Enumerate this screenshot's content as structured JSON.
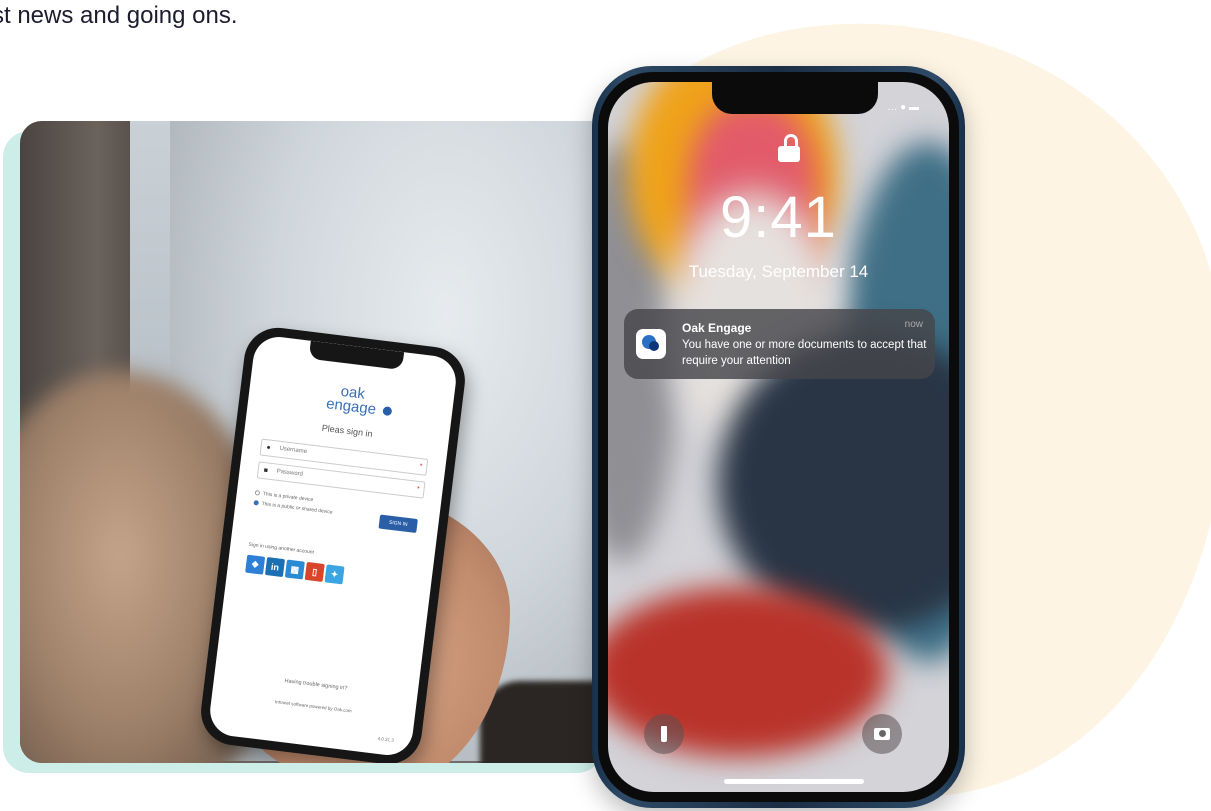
{
  "intro": {
    "text": "st news and going ons."
  },
  "phone_login": {
    "logo_oak": "oak",
    "logo_engage": "engage",
    "heading": "Pleas sign in",
    "username_placeholder": "Username",
    "password_placeholder": "Password",
    "required_mark": "*",
    "radio_private": "This is a private device",
    "radio_shared": "This is a public or shared device",
    "signin_button": "SIGN IN",
    "alt_signin_label": "Sign in using another account",
    "social_icons": [
      "dropbox-icon",
      "linkedin-icon",
      "windows-icon",
      "office-icon",
      "twitter-icon"
    ],
    "trouble_link": "Having trouble signing in?",
    "powered_by": "Intranet software powered by Oak.com",
    "version": "4.0.31.3"
  },
  "lock_screen": {
    "time": "9:41",
    "date": "Tuesday, September 14",
    "notification": {
      "app_name": "Oak Engage",
      "time": "now",
      "message": "You have one or more documents to accept that require your attention"
    }
  },
  "colors": {
    "blob": "#fdf4e4",
    "photo_backing": "#cdeee8",
    "oak_blue": "#2b6fc4"
  }
}
